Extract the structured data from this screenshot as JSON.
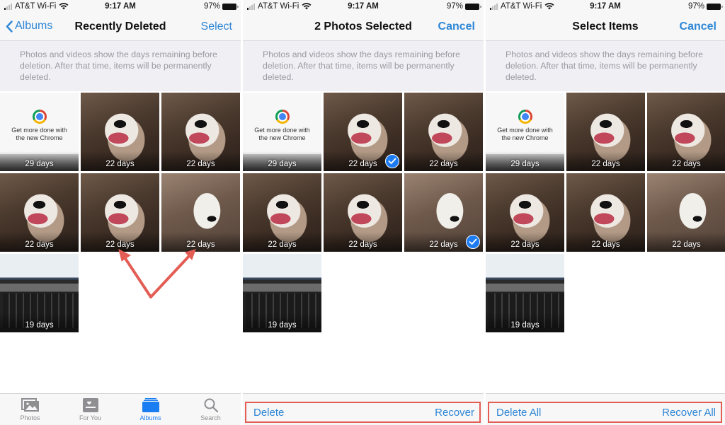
{
  "status_bar": {
    "carrier": "AT&T Wi-Fi",
    "time": "9:17 AM",
    "battery": "97%"
  },
  "info_text": "Photos and videos show the days remaining before deletion. After that time, items will be permanently deleted.",
  "colors": {
    "accent": "#2d86d6",
    "tab_active": "#1a7ef2",
    "highlight_box": "#e35d55",
    "check_badge": "#1d7cf2"
  },
  "chrome_promo": {
    "line1": "Get more done with",
    "line2": "the new Chrome"
  },
  "tiles": [
    {
      "kind": "chrome",
      "days": "29 days"
    },
    {
      "kind": "dog",
      "days": "22 days"
    },
    {
      "kind": "dog",
      "days": "22 days"
    },
    {
      "kind": "dog",
      "days": "22 days"
    },
    {
      "kind": "dog",
      "days": "22 days"
    },
    {
      "kind": "dog2",
      "days": "22 days"
    },
    {
      "kind": "laptop",
      "days": "19 days"
    }
  ],
  "panels": [
    {
      "nav": {
        "back_label": "Albums",
        "title": "Recently Deleted",
        "right_label": "Select"
      },
      "selected": [],
      "tabbar": [
        {
          "label": "Photos",
          "icon": "photos-icon",
          "active": false
        },
        {
          "label": "For You",
          "icon": "for-you-icon",
          "active": false
        },
        {
          "label": "Albums",
          "icon": "albums-icon",
          "active": true
        },
        {
          "label": "Search",
          "icon": "search-icon",
          "active": false
        }
      ]
    },
    {
      "nav": {
        "title": "2 Photos Selected",
        "right_label": "Cancel"
      },
      "selected": [
        1,
        5
      ],
      "toolbar": {
        "left_label": "Delete",
        "right_label": "Recover"
      }
    },
    {
      "nav": {
        "title": "Select Items",
        "right_label": "Cancel"
      },
      "selected": [],
      "toolbar": {
        "left_label": "Delete All",
        "right_label": "Recover All"
      }
    }
  ]
}
